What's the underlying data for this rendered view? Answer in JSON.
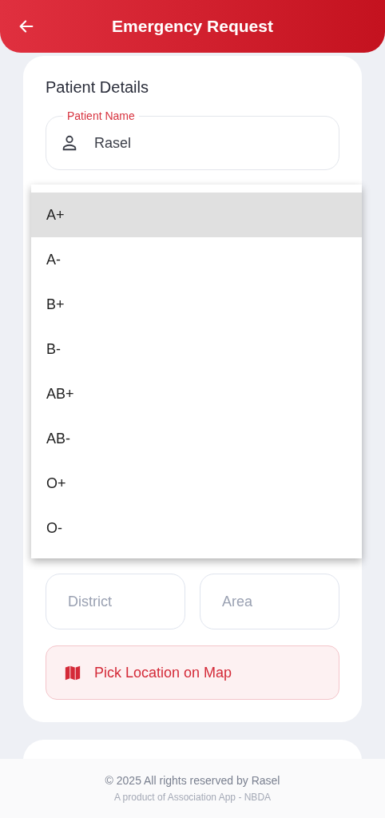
{
  "header": {
    "title": "Emergency Request"
  },
  "patient_details": {
    "title": "Patient Details",
    "name_field": {
      "label": "Patient Name",
      "value": "Rasel"
    }
  },
  "blood_group_menu": [
    {
      "label": "A+",
      "selected": true
    },
    {
      "label": "A-",
      "selected": false
    },
    {
      "label": "B+",
      "selected": false
    },
    {
      "label": "B-",
      "selected": false
    },
    {
      "label": "AB+",
      "selected": false
    },
    {
      "label": "AB-",
      "selected": false
    },
    {
      "label": "O+",
      "selected": false
    },
    {
      "label": "O-",
      "selected": false
    }
  ],
  "location": {
    "district": {
      "placeholder": "District"
    },
    "area": {
      "placeholder": "Area"
    },
    "map_button": "Pick Location on Map"
  },
  "footer": {
    "copyright": "© 2025 All rights reserved by Rasel",
    "product": "A product of Association App - NBDA"
  }
}
